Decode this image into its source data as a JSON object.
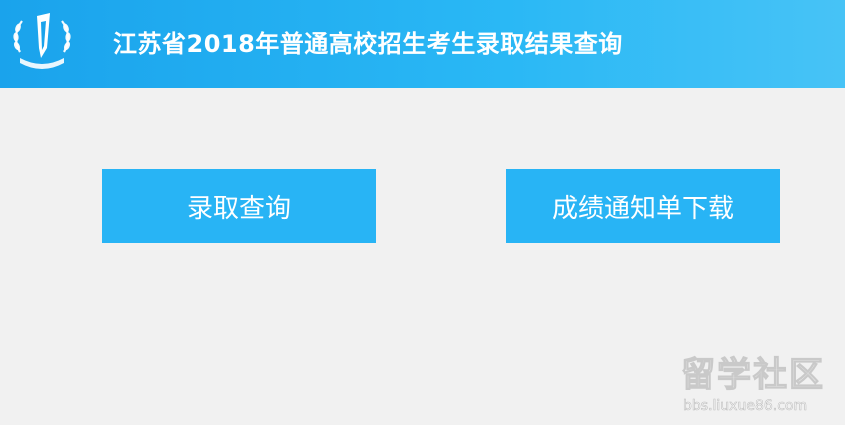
{
  "header": {
    "title": "江苏省2018年普通高校招生考生录取结果查询",
    "logo_icon": "emblem-laurel-pen-icon",
    "background_color": "#1aa3ec"
  },
  "actions": {
    "admission_query_label": "录取查询",
    "score_notice_download_label": "成绩通知单下载",
    "button_color": "#28b4f5"
  },
  "watermark": {
    "brand": "留学社区",
    "url": "bbs.liuxue86.com"
  }
}
